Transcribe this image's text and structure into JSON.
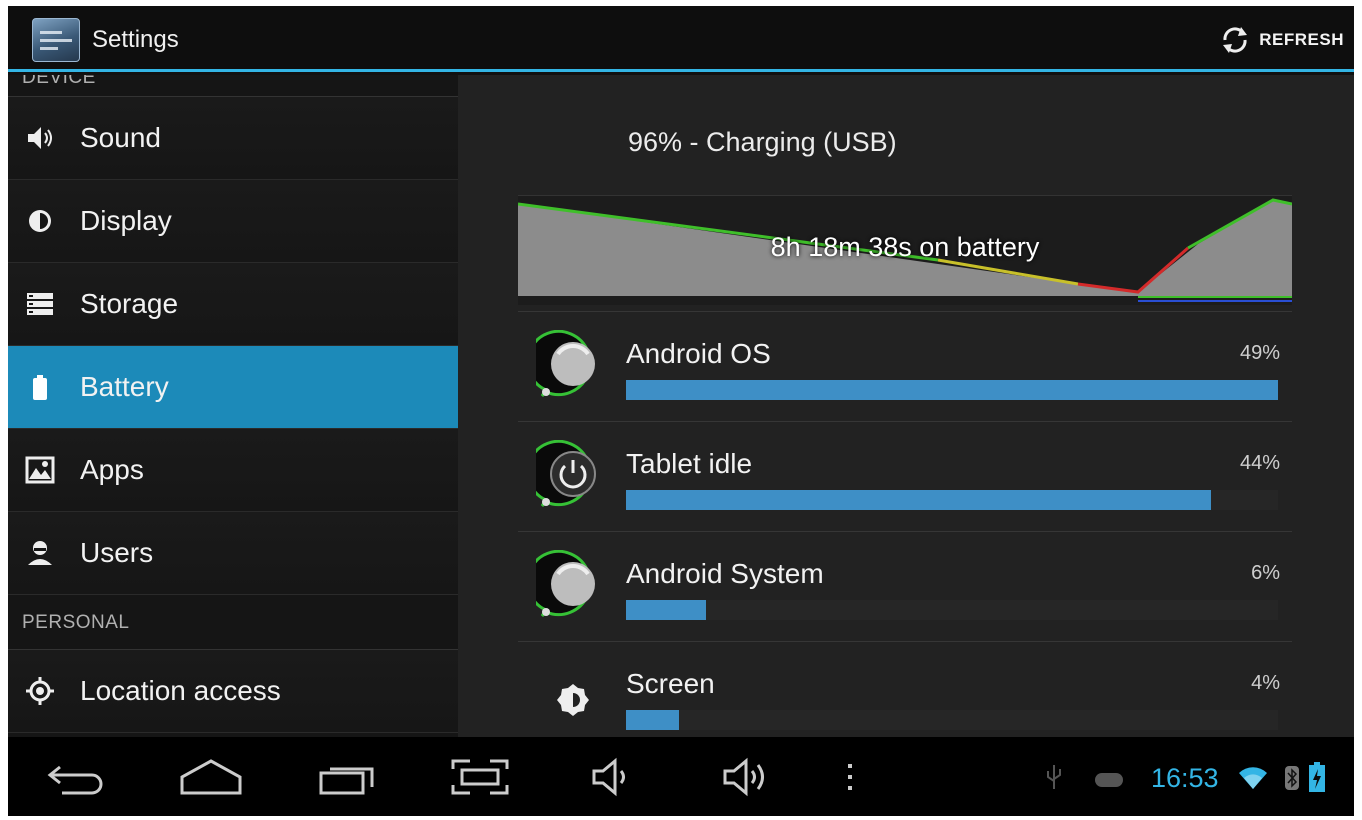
{
  "action_bar": {
    "title": "Settings",
    "refresh_label": "REFRESH",
    "refresh_icon": "refresh-icon",
    "accent_color": "#33b5e5"
  },
  "sidebar": {
    "top_section_header": "DEVICE",
    "items": [
      {
        "label": "Sound",
        "icon": "speaker-icon"
      },
      {
        "label": "Display",
        "icon": "brightness-icon"
      },
      {
        "label": "Storage",
        "icon": "storage-icon"
      },
      {
        "label": "Battery",
        "icon": "battery-icon",
        "selected": true
      },
      {
        "label": "Apps",
        "icon": "apps-icon"
      },
      {
        "label": "Users",
        "icon": "user-icon"
      }
    ],
    "personal_header": "PERSONAL",
    "personal_items": [
      {
        "label": "Location access",
        "icon": "location-icon"
      }
    ],
    "selected_color": "#1c8ab9"
  },
  "battery": {
    "summary": "96% - Charging (USB)",
    "graph_label": "8h 18m 38s on battery",
    "usage": [
      {
        "name": "Android OS",
        "percent_label": "49%",
        "fraction": 0.49,
        "icon": "android-os-icon"
      },
      {
        "name": "Tablet idle",
        "percent_label": "44%",
        "fraction": 0.44,
        "icon": "power-icon"
      },
      {
        "name": "Android System",
        "percent_label": "6%",
        "fraction": 0.06,
        "icon": "android-system-icon"
      },
      {
        "name": "Screen",
        "percent_label": "4%",
        "fraction": 0.04,
        "icon": "brightness-icon"
      }
    ],
    "bar_color": "#3e8fc6"
  },
  "nav_bar": {
    "buttons": [
      "back-icon",
      "home-icon",
      "recents-icon",
      "screenshot-icon",
      "volume-down-icon",
      "volume-up-icon",
      "menu-icon"
    ],
    "status_icons": [
      "usb-icon",
      "gamepad-icon",
      "wifi-icon",
      "bluetooth-icon",
      "battery-charging-icon"
    ],
    "clock": "16:53"
  }
}
